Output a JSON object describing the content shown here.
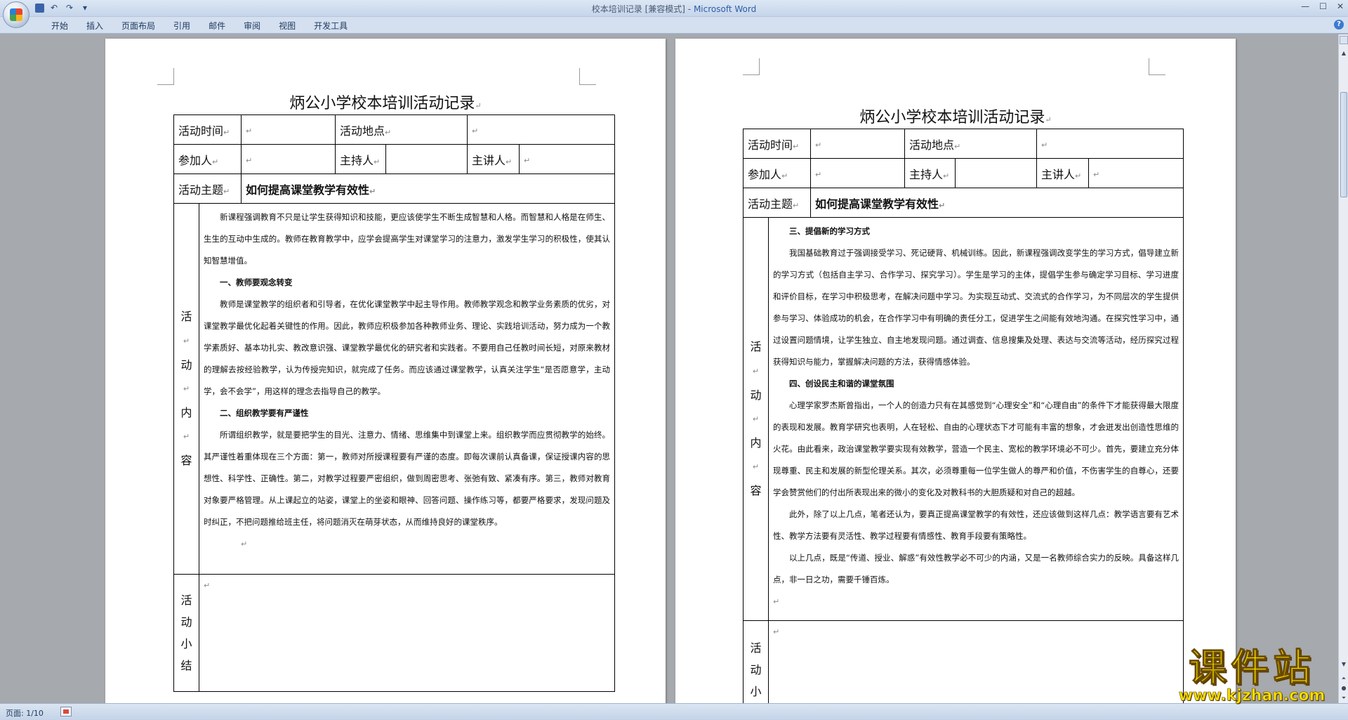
{
  "window": {
    "title": "校本培训记录 [兼容模式]",
    "app_name": "Microsoft Word",
    "separator": "-"
  },
  "ribbon": {
    "tabs": [
      "开始",
      "插入",
      "页面布局",
      "引用",
      "邮件",
      "审阅",
      "视图",
      "开发工具"
    ]
  },
  "status": {
    "page": "页面: 1/10"
  },
  "watermark": {
    "name": "课件站",
    "url": "www.kjzhan.com"
  },
  "labels": {
    "time": "活动时间",
    "place": "活动地点",
    "participants": "参加人",
    "host": "主持人",
    "speaker": "主讲人",
    "topic": "活动主题",
    "content_chars": [
      "活",
      "动",
      "内",
      "容"
    ],
    "summary_chars": [
      "活",
      "动",
      "小",
      "结"
    ],
    "mark": "↵"
  },
  "pages": [
    {
      "title": "炳公小学校本培训活动记录",
      "topic": "如何提高课堂教学有效性",
      "paragraphs": [
        {
          "type": "p",
          "text": "新课程强调教育不只是让学生获得知识和技能，更应该使学生不断生成智慧和人格。而智慧和人格是在师生、生生的互动中生成的。教师在教育教学中，应学会提高学生对课堂学习的注意力，激发学生学习的积极性，使其认知智慧增值。"
        },
        {
          "type": "h",
          "text": "一、教师要观念转变"
        },
        {
          "type": "p",
          "text": "教师是课堂教学的组织者和引导者，在优化课堂教学中起主导作用。教师教学观念和教学业务素质的优劣，对课堂教学最优化起着关键性的作用。因此，教师应积极参加各种教师业务、理论、实践培训活动，努力成为一个教学素质好、基本功扎实、教改意识强、课堂教学最优化的研究者和实践者。不要用自己任教时间长短，对原来教材的理解去按经验教学，认为传授完知识，就完成了任务。而应该通过课堂教学，认真关注学生“是否愿意学，主动学，会不会学”，用这样的理念去指导自己的教学。"
        },
        {
          "type": "h",
          "text": "二、组织教学要有严谨性"
        },
        {
          "type": "p",
          "text": "所谓组织教学，就是要把学生的目光、注意力、情绪、思维集中到课堂上来。组织教学而应贯彻教学的始终。其严谨性着重体现在三个方面：第一，教师对所授课程要有严谨的态度。即每次课前认真备课，保证授课内容的思想性、科学性、正确性。第二，对教学过程要严密组织，做到周密思考、张弛有致、紧凑有序。第三，教师对教育对象要严格管理。从上课起立的站姿，课堂上的坐姿和眼神、回答问题、操作练习等，都要严格要求，发现问题及时纠正，不把问题推给班主任，将问题消灭在萌芽状态，从而维持良好的课堂秩序。"
        }
      ]
    },
    {
      "title": "炳公小学校本培训活动记录",
      "topic": "如何提高课堂教学有效性",
      "paragraphs": [
        {
          "type": "h",
          "text": "三、提倡新的学习方式"
        },
        {
          "type": "p",
          "text": "我国基础教育过于强调接受学习、死记硬背、机械训练。因此，新课程强调改变学生的学习方式，倡导建立新的学习方式（包括自主学习、合作学习、探究学习）。学生是学习的主体，提倡学生参与确定学习目标、学习进度和评价目标，在学习中积极思考，在解决问题中学习。为实现互动式、交流式的合作学习，为不同层次的学生提供参与学习、体验成功的机会，在合作学习中有明确的责任分工，促进学生之间能有效地沟通。在探究性学习中，通过设置问题情境，让学生独立、自主地发现问题。通过调查、信息搜集及处理、表达与交流等活动，经历探究过程获得知识与能力，掌握解决问题的方法，获得情感体验。"
        },
        {
          "type": "h",
          "text": "四、创设民主和谐的课堂氛围"
        },
        {
          "type": "p",
          "text": "心理学家罗杰斯曾指出，一个人的创造力只有在其感觉到“心理安全”和“心理自由”的条件下才能获得最大限度的表现和发展。教育学研究也表明，人在轻松、自由的心理状态下才可能有丰富的想象，才会迸发出创造性思维的火花。由此看来，政治课堂教学要实现有效教学，营造一个民主、宽松的教学环境必不可少。首先，要建立充分体现尊重、民主和发展的新型伦理关系。其次，必须尊重每一位学生做人的尊严和价值，不伤害学生的自尊心，还要学会赞赏他们的付出所表现出来的微小的变化及对教科书的大胆质疑和对自己的超越。"
        },
        {
          "type": "p",
          "text": "此外，除了以上几点，笔者还认为，要真正提高课堂教学的有效性，还应该做到这样几点：教学语言要有艺术性、教学方法要有灵活性、教学过程要有情感性、教育手段要有策略性。"
        },
        {
          "type": "p",
          "text": "以上几点，既是“传道、授业、解惑”有效性教学必不可少的内涵，又是一名教师综合实力的反映。具备这样几点，非一日之功，需要千锤百炼。"
        }
      ]
    }
  ]
}
